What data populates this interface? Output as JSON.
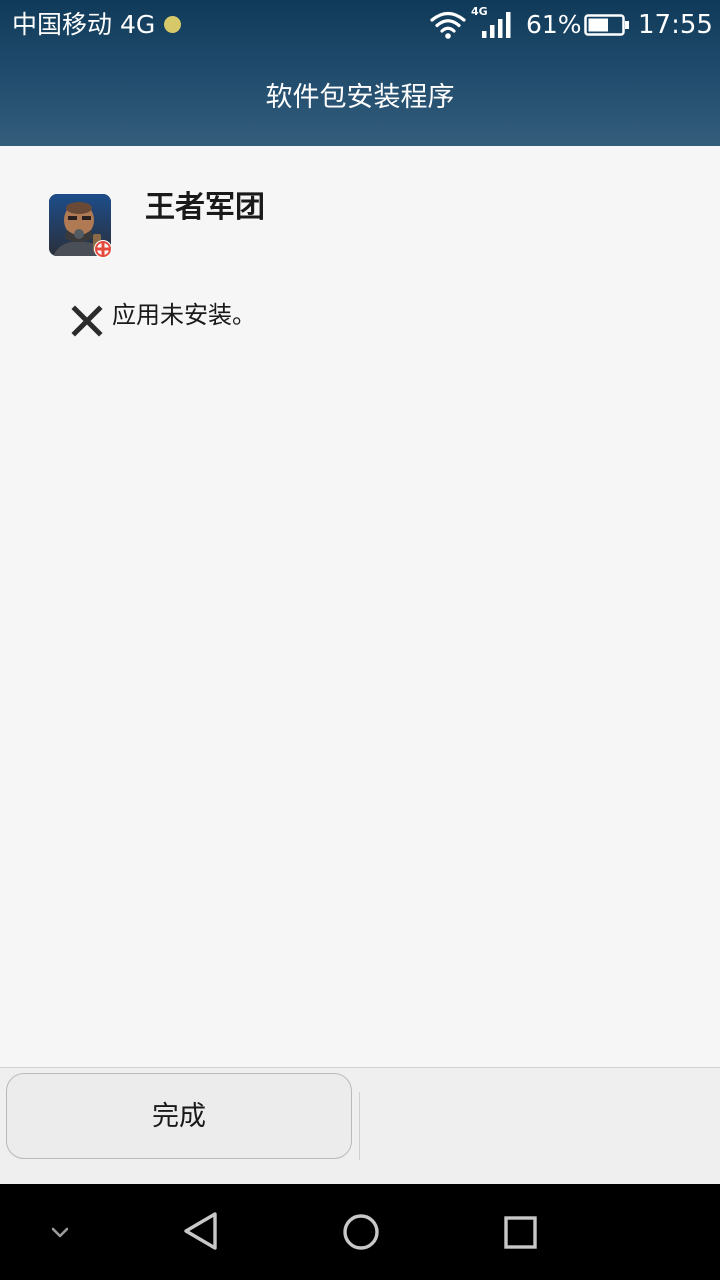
{
  "status_bar": {
    "carrier": "中国移动 4G",
    "network_type": "4G",
    "battery_percent": "61%",
    "battery_level": 0.61,
    "time": "17:55",
    "icons": [
      "notification-dot-icon",
      "wifi-icon",
      "signal-icon",
      "battery-icon"
    ],
    "notif_dot_color": "#d7c96a"
  },
  "header": {
    "title": "软件包安装程序",
    "gradient_colors": [
      "#0f3a59",
      "#345d7c"
    ]
  },
  "app": {
    "name": "王者军团",
    "icon": "game-app-icon"
  },
  "install_status": {
    "icon": "close-x-icon",
    "message": "应用未安装。"
  },
  "actions": {
    "done_label": "完成"
  },
  "nav_bar": {
    "buttons": [
      "collapse-chevron-icon",
      "back-triangle-icon",
      "home-circle-icon",
      "recents-square-icon"
    ]
  }
}
